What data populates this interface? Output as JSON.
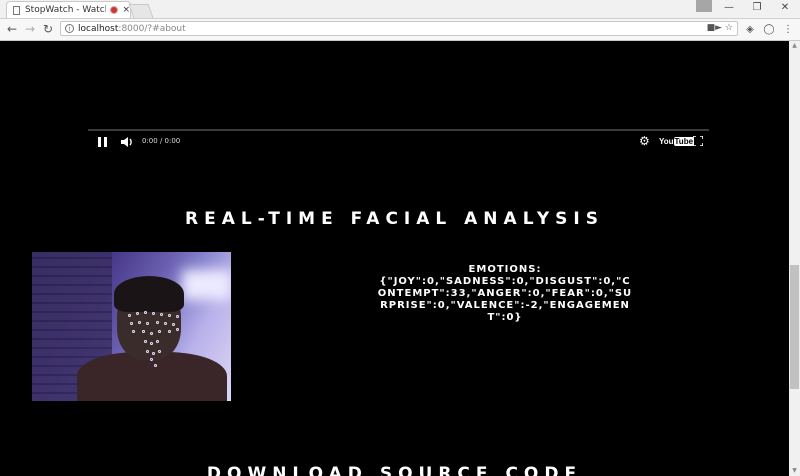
{
  "browser": {
    "tab_title": "StopWatch - Watch V",
    "tab_close": "×",
    "url_host": "localhost",
    "url_rest": ":8000/?#about",
    "window_controls": [
      "—",
      "❐",
      "✕"
    ],
    "nav_icons": [
      "back-icon",
      "forward-icon",
      "reload-icon"
    ]
  },
  "video": {
    "time": "0:00 / 0:00",
    "youtube_you": "You",
    "youtube_tube": "Tube"
  },
  "analysis": {
    "title": "REAL-TIME FACIAL ANALYSIS",
    "emotions_label": "EMOTIONS:",
    "emotions_json": "{\"JOY\":0,\"SADNESS\":0,\"DISGUST\":0,\"CONTEMPT\":33,\"ANGER\":0,\"FEAR\":0,\"SURPRISE\":0,\"VALENCE\":-2,\"ENGAGEMENT\":0}"
  },
  "download": {
    "title": "DOWNLOAD SOURCE CODE"
  },
  "colors": {
    "page_background": "#000000",
    "text": "#ffffff",
    "tab_recording_dot": "#c23c3c"
  }
}
